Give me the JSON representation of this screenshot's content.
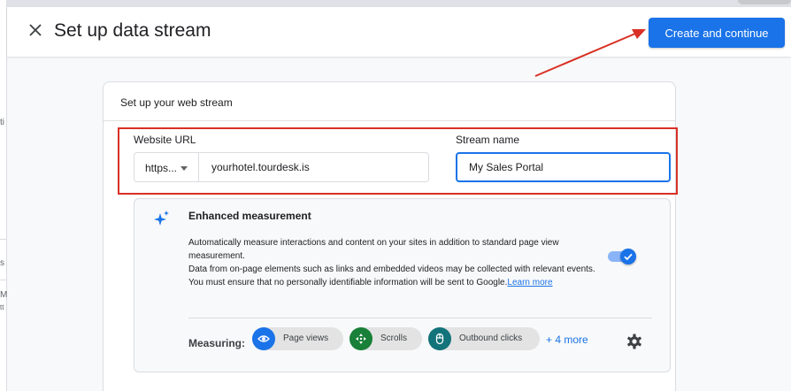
{
  "header": {
    "title": "Set up data stream",
    "create_button": "Create and continue"
  },
  "card": {
    "title": "Set up your web stream",
    "website_url_label": "Website URL",
    "protocol_value": "https...",
    "url_value": "yourhotel.tourdesk.is",
    "stream_name_label": "Stream name",
    "stream_name_value": "My Sales Portal"
  },
  "enhanced_measurement": {
    "title": "Enhanced measurement",
    "description_line1": "Automatically measure interactions and content on your sites in addition to standard page view measurement.",
    "description_line2": "Data from on-page elements such as links and embedded videos may be collected with relevant events. You must ensure that no personally identifiable information will be sent to Google.",
    "learn_more": "Learn more",
    "toggle_on": true,
    "measuring_label": "Measuring:",
    "chips": [
      {
        "label": "Page views",
        "icon": "eye-icon",
        "color": "#1a73e8"
      },
      {
        "label": "Scrolls",
        "icon": "scroll-icon",
        "color": "#188038"
      },
      {
        "label": "Outbound clicks",
        "icon": "mouse-icon",
        "color": "#12737a"
      }
    ],
    "more_link": "+ 4 more"
  },
  "background_fragments": [
    "ti",
    "s",
    "M",
    "tt"
  ],
  "colors": {
    "accent": "#1a73e8",
    "annotation_red": "#d93025"
  }
}
